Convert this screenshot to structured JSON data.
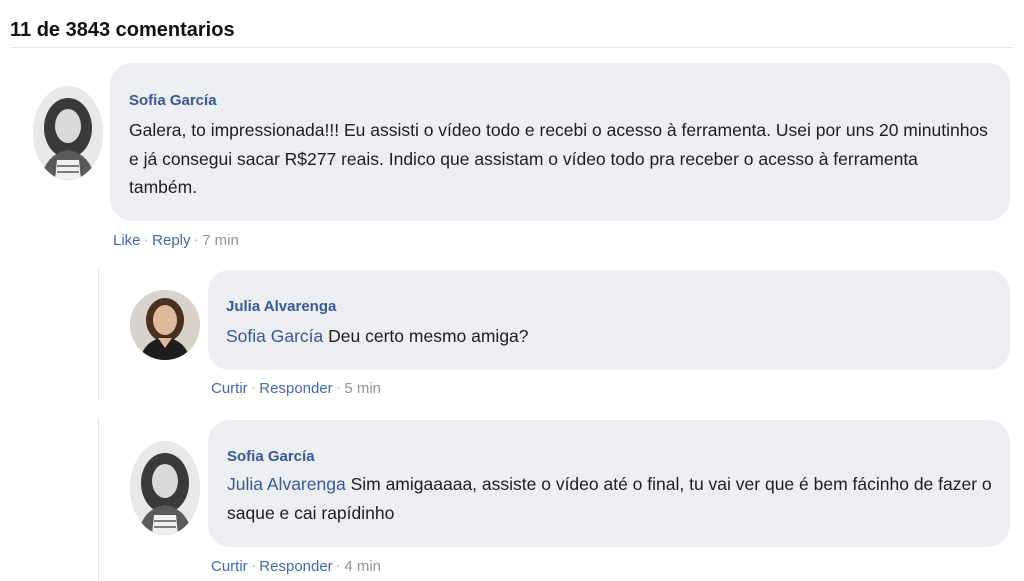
{
  "header": {
    "title": "11 de 3843 comentarios"
  },
  "comments": [
    {
      "author": "Sofia García",
      "text": "Galera, to impressionada!!! Eu assisti o vídeo todo e recebi o acesso à ferramenta. Usei por uns 20 minutinhos e já consegui sacar R$277 reais. Indico que assistam o vídeo todo pra receber o acesso à ferramenta também.",
      "actions": {
        "like": "Like",
        "reply": "Reply",
        "time": "7 min"
      },
      "avatar": "sofia-bw-avatar"
    },
    {
      "author": "Julia Alvarenga",
      "mention": "Sofia García",
      "text": "Deu certo mesmo amiga?",
      "actions": {
        "like": "Curtir",
        "reply": "Responder",
        "time": "5 min"
      },
      "avatar": "julia-color-avatar"
    },
    {
      "author": "Sofia García",
      "mention": "Julia Alvarenga",
      "text": "Sim amigaaaaa, assiste o vídeo até o final, tu vai ver que é bem fácinho de fazer o saque e cai rapídinho",
      "actions": {
        "like": "Curtir",
        "reply": "Responder",
        "time": "4 min"
      },
      "avatar": "sofia-bw-avatar"
    }
  ],
  "colors": {
    "link": "#385898",
    "action": "#4267b2",
    "bubble": "#eceef1",
    "muted": "#90949c"
  }
}
